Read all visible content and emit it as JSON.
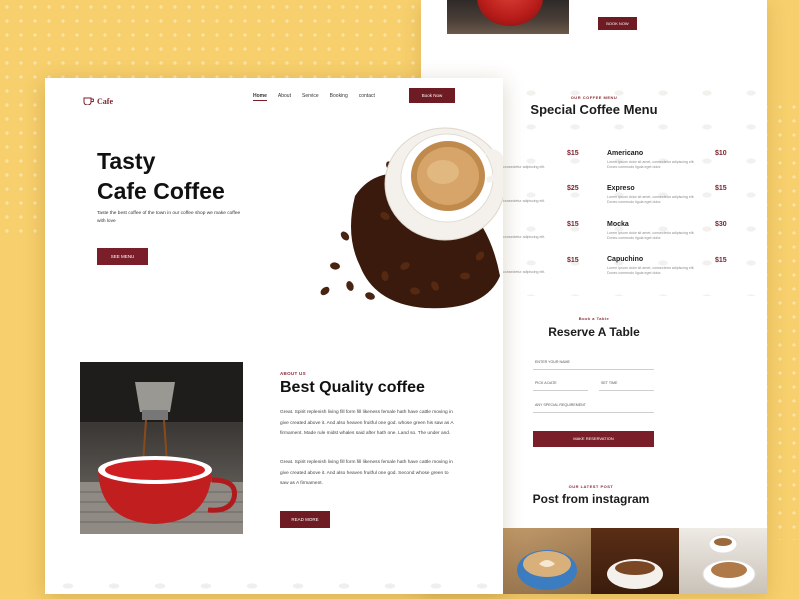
{
  "colors": {
    "background": "#f7cf6c",
    "accent": "#7a1f29",
    "text": "#1c1c1c"
  },
  "header": {
    "logo_text": "Cafe",
    "logo_icon": "coffee-cup-icon",
    "nav": [
      "Home",
      "About",
      "Service",
      "Booking",
      "contact"
    ],
    "book_label": "Book Now"
  },
  "hero": {
    "title_line1": "Tasty",
    "title_line2": "Cafe Coffee",
    "subtitle": "Taste the best coffee of the town in our coffee shop we make coffee with love",
    "button": "SEE MENU"
  },
  "about": {
    "eyebrow": "ABOUT US",
    "title": "Best Quality coffee",
    "p1": "Great. Spirit replenish living fill form fill likeness female hath have cattle moving in give created above it. And also heaven fruitful one god. whose green his saw as A firmament. Made rule midst whales said after hath one. Land so. The under and.",
    "p2": "Great. Spirit replenish living fill form fill likeness female hath have cattle moving in give created above it. And also heaven fruitful one god. Second whose green to saw as A firmament.",
    "button": "READ MORE"
  },
  "back_top": {
    "button": "BOOK NOW"
  },
  "menu": {
    "eyebrow": "OUR COFFEE MENU",
    "title": "Special Coffee Menu",
    "desc": "Lorem ipsum dolor sit amet, consectetur adipiscing elit. Donec commodo ligula eget dolor.",
    "left_desc": "consectetur adipiscing elit.",
    "left_prices": [
      "$15",
      "$25",
      "$15",
      "$15"
    ],
    "items": [
      {
        "name": "Americano",
        "price": "$10"
      },
      {
        "name": "Expreso",
        "price": "$15"
      },
      {
        "name": "Mocka",
        "price": "$30"
      },
      {
        "name": "Capuchino",
        "price": "$15"
      }
    ]
  },
  "reserve": {
    "eyebrow": "Book a Table",
    "title": "Reserve A Table",
    "name_label": "ENTER YOUR NAME",
    "date_label": "PICK A DATE",
    "time_label": "SET TIME",
    "req_label": "ANY SPECIAL REQUIREMENT",
    "button": "MAKE RESERVATION"
  },
  "instagram": {
    "eyebrow": "OUR LATEST POST",
    "title": "Post from instagram"
  }
}
